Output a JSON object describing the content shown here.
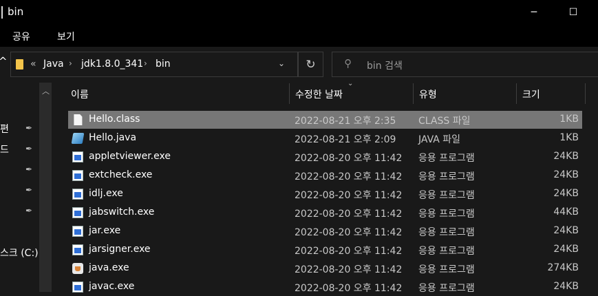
{
  "window": {
    "title": "bin"
  },
  "window_controls": {
    "minimize": "─",
    "maximize": "☐"
  },
  "ribbon": {
    "tabs": [
      "공유",
      "보기"
    ]
  },
  "address": {
    "overflow": "«",
    "parts": [
      "Java",
      "jdk1.8.0_341",
      "bin"
    ],
    "dropdown": "⌄",
    "refresh": "↻"
  },
  "search": {
    "placeholder": "bin 검색"
  },
  "nav": {
    "items": [
      "편",
      "드",
      "",
      "",
      "",
      "스크 (C:)"
    ]
  },
  "columns": {
    "name": "이름",
    "date": "수정한 날짜",
    "type": "유형",
    "size": "크기",
    "sort": "⌄"
  },
  "files": [
    {
      "icon": "class-file-icon",
      "name": "Hello.class",
      "date": "2022-08-21 오후 2:35",
      "type": "CLASS 파일",
      "size": "1KB",
      "selected": true
    },
    {
      "icon": "java-file-icon",
      "name": "Hello.java",
      "date": "2022-08-21 오후 2:09",
      "type": "JAVA 파일",
      "size": "1KB",
      "selected": false
    },
    {
      "icon": "exe-file-icon",
      "name": "appletviewer.exe",
      "date": "2022-08-20 오후 11:42",
      "type": "응용 프로그램",
      "size": "24KB",
      "selected": false
    },
    {
      "icon": "exe-file-icon",
      "name": "extcheck.exe",
      "date": "2022-08-20 오후 11:42",
      "type": "응용 프로그램",
      "size": "24KB",
      "selected": false
    },
    {
      "icon": "exe-file-icon",
      "name": "idlj.exe",
      "date": "2022-08-20 오후 11:42",
      "type": "응용 프로그램",
      "size": "24KB",
      "selected": false
    },
    {
      "icon": "exe-file-icon",
      "name": "jabswitch.exe",
      "date": "2022-08-20 오후 11:42",
      "type": "응용 프로그램",
      "size": "44KB",
      "selected": false
    },
    {
      "icon": "exe-file-icon",
      "name": "jar.exe",
      "date": "2022-08-20 오후 11:42",
      "type": "응용 프로그램",
      "size": "24KB",
      "selected": false
    },
    {
      "icon": "exe-file-icon",
      "name": "jarsigner.exe",
      "date": "2022-08-20 오후 11:42",
      "type": "응용 프로그램",
      "size": "24KB",
      "selected": false
    },
    {
      "icon": "java-cup-icon",
      "name": "java.exe",
      "date": "2022-08-20 오후 11:42",
      "type": "응용 프로그램",
      "size": "274KB",
      "selected": false
    },
    {
      "icon": "exe-file-icon",
      "name": "javac.exe",
      "date": "2022-08-20 오후 11:42",
      "type": "응용 프로그램",
      "size": "24KB",
      "selected": false
    }
  ]
}
